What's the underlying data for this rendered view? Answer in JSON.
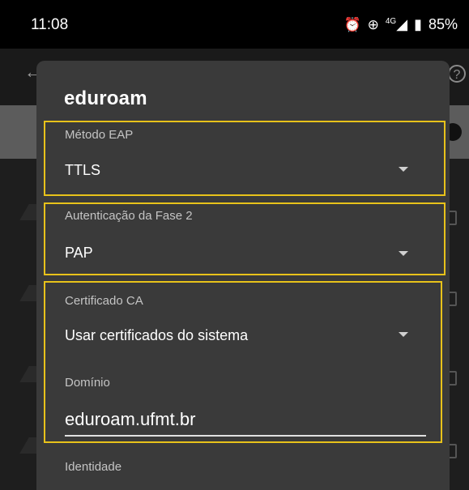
{
  "status_bar": {
    "time": "11:08",
    "icons": [
      "alarm-icon",
      "data-saver-icon",
      "signal-4g-icon",
      "battery-icon"
    ],
    "network": "4G",
    "battery": "85%"
  },
  "dialog": {
    "title": "eduroam",
    "eap_method": {
      "label": "Método EAP",
      "value": "TTLS"
    },
    "phase2": {
      "label": "Autenticação da Fase 2",
      "value": "PAP"
    },
    "ca_cert": {
      "label": "Certificado CA",
      "value": "Usar certificados do sistema"
    },
    "domain": {
      "label": "Domínio",
      "value": "eduroam.ufmt.br"
    },
    "identity": {
      "label": "Identidade"
    }
  },
  "colors": {
    "dialog_bg": "#3a3a3a",
    "highlight": "#e8c21a",
    "label_text": "#c4c4c4"
  }
}
